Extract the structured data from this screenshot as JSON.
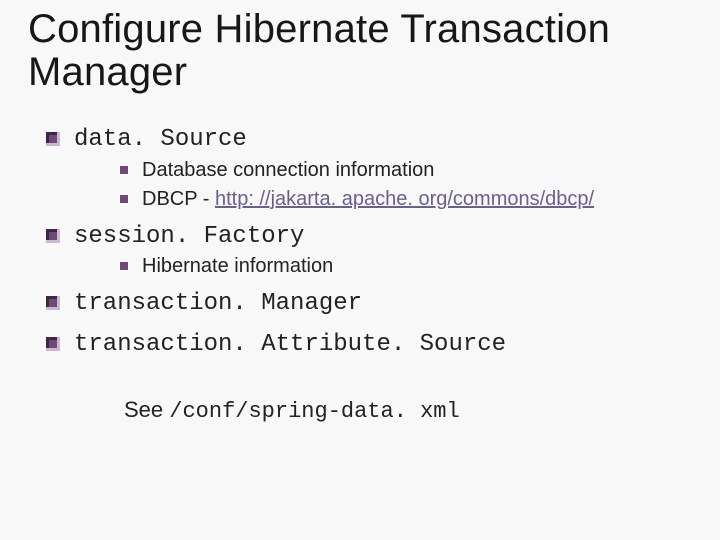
{
  "title": "Configure Hibernate Transaction Manager",
  "items": [
    {
      "label": "data. Source",
      "sub": [
        {
          "text": "Database connection information"
        },
        {
          "prefix": "DBCP - ",
          "link": "http: //jakarta. apache. org/commons/dbcp/"
        }
      ]
    },
    {
      "label": "session. Factory",
      "sub": [
        {
          "text": "Hibernate information"
        }
      ]
    },
    {
      "label": "transaction. Manager"
    },
    {
      "label": "transaction. Attribute. Source"
    }
  ],
  "footer": {
    "lead": "See ",
    "path": "/conf/spring-data. xml"
  }
}
